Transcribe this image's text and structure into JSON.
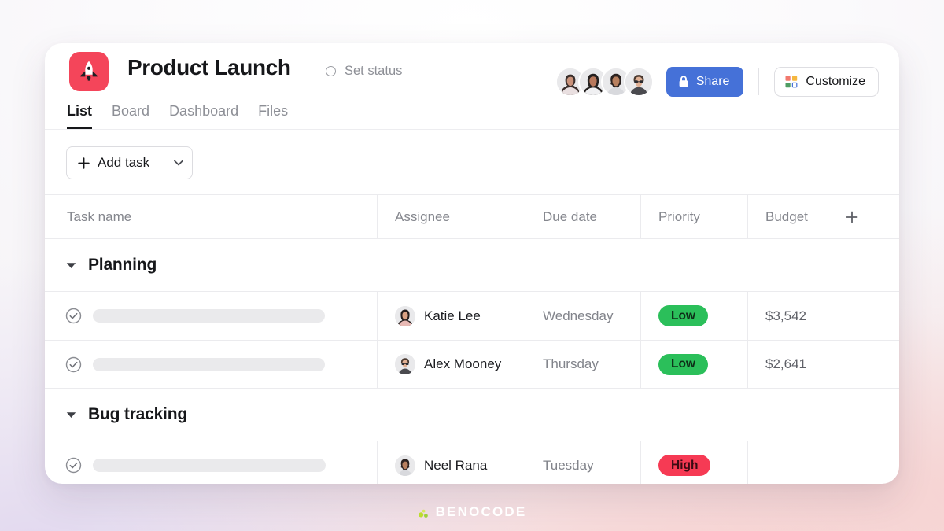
{
  "header": {
    "project_icon": "rocket-icon",
    "title": "Product Launch",
    "status_icon": "circle-outline-icon",
    "status_label": "Set status",
    "share_label": "Share",
    "share_icon": "lock-icon",
    "customize_label": "Customize",
    "customize_icon": "color-grid-icon",
    "accent_color": "#4571d8",
    "project_icon_color": "#f4455a",
    "avatar_count": 4
  },
  "tabs": [
    {
      "label": "List",
      "active": true
    },
    {
      "label": "Board",
      "active": false
    },
    {
      "label": "Dashboard",
      "active": false
    },
    {
      "label": "Files",
      "active": false
    }
  ],
  "toolbar": {
    "add_task_label": "Add task",
    "add_task_icon": "plus-icon",
    "add_task_caret_icon": "chevron-down-icon"
  },
  "table": {
    "columns": [
      "Task name",
      "Assignee",
      "Due date",
      "Priority",
      "Budget"
    ],
    "add_column_icon": "plus-icon",
    "sections": [
      {
        "name": "Planning",
        "collapse_icon": "caret-down-icon",
        "rows": [
          {
            "task_name": "",
            "check_icon": "check-circle-icon",
            "assignee": "Katie Lee",
            "due_date": "Wednesday",
            "priority": "Low",
            "priority_color": "#2bbf5a",
            "budget": "$3,542"
          },
          {
            "task_name": "",
            "check_icon": "check-circle-icon",
            "assignee": "Alex Mooney",
            "due_date": "Thursday",
            "priority": "Low",
            "priority_color": "#2bbf5a",
            "budget": "$2,641"
          }
        ]
      },
      {
        "name": "Bug tracking",
        "collapse_icon": "caret-down-icon",
        "rows": [
          {
            "task_name": "",
            "check_icon": "check-circle-icon",
            "assignee": "Neel Rana",
            "due_date": "Tuesday",
            "priority": "High",
            "priority_color": "#f63a54",
            "budget": ""
          }
        ]
      }
    ]
  },
  "watermark": {
    "text": "BENOCODE",
    "mark_icon": "benocode-mark-icon"
  }
}
